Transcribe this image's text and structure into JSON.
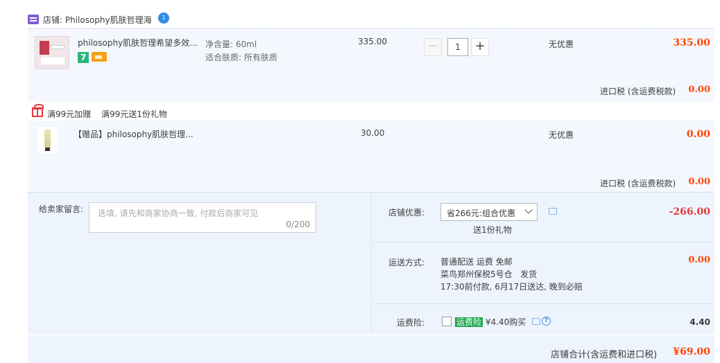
{
  "shop": {
    "label": "店铺: Philosophy肌肤哲理海",
    "ww_badge": "1"
  },
  "item1": {
    "title": "philosophy肌肤哲理希望多效...",
    "attr1": "净含量: 60ml",
    "attr2": "适合肤质: 所有肤质",
    "unit_price": "335.00",
    "qty": "1",
    "discount": "无优惠",
    "subtotal": "335.00",
    "tax_label": "进口税 (含运费税款)",
    "tax_value": "0.00",
    "badge_seven": "7"
  },
  "gift_section": {
    "promo1": "满99元加赠",
    "promo2": "满99元送1份礼物"
  },
  "item2": {
    "title": "【赠品】philosophy肌肤哲理...",
    "unit_price": "30.00",
    "discount": "无优惠",
    "subtotal": "0.00",
    "tax_label": "进口税 (含运费税款)",
    "tax_value": "0.00"
  },
  "memo": {
    "label": "给卖家留言:",
    "placeholder": "选填, 请先和商家协商一致, 付款后商家可见",
    "counter": "0/200"
  },
  "shop_discount": {
    "label": "店铺优惠:",
    "selected": "省266元:组合优惠",
    "note": "送1份礼物",
    "value": "-266.00"
  },
  "shipping": {
    "label": "运送方式:",
    "line1": "普通配送 运费 免邮",
    "line2a": "菜鸟郑州保税5号仓",
    "line2b": "发货",
    "line3": "17:30前付款, 6月17日送达, 晚到必赔",
    "value": "0.00"
  },
  "insurance": {
    "label": "运费险:",
    "tag": "运费险",
    "price": "¥4.40购买",
    "value": "4.40"
  },
  "total": {
    "label": "店铺合计(含运费和进口税)",
    "value": "¥69.00"
  },
  "colors": {
    "price_red": "#ff4400",
    "accent_blue": "#2e8fe8",
    "bg_blue": "#eef4fd"
  }
}
